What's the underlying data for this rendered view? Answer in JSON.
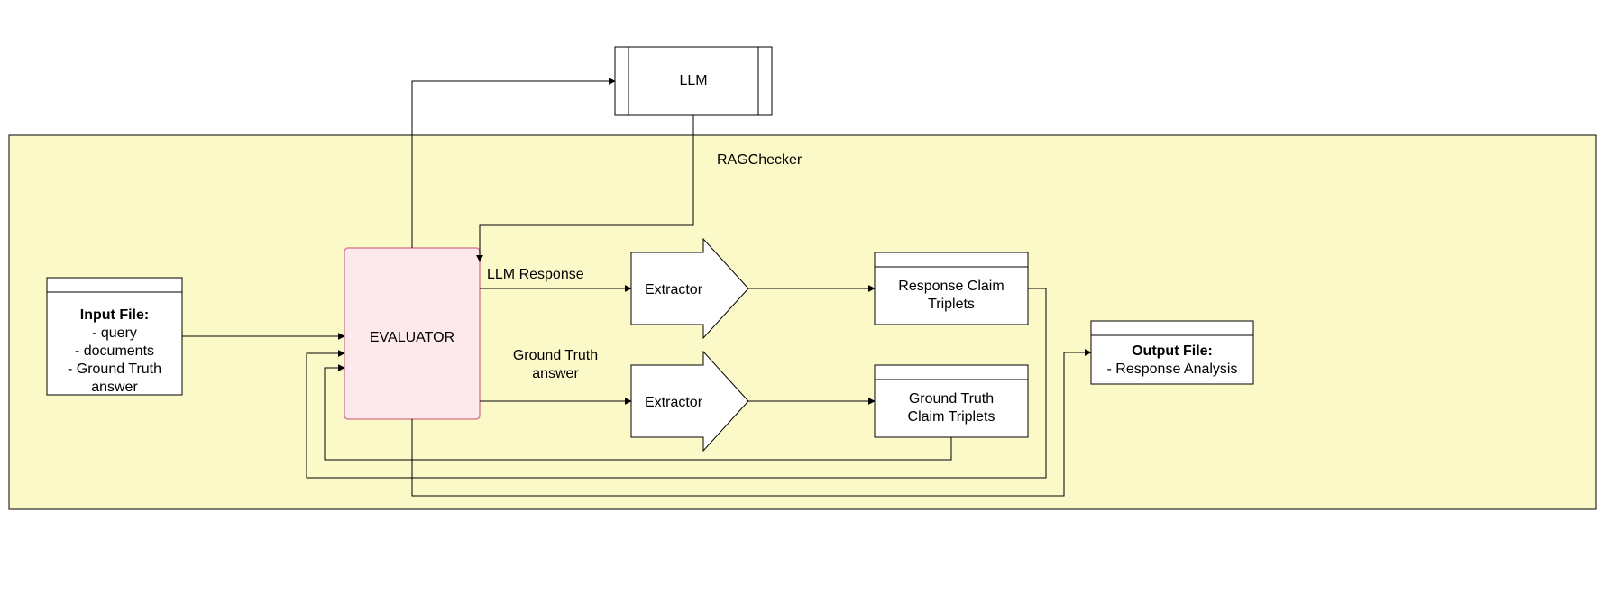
{
  "nodes": {
    "llm": {
      "label": "LLM"
    },
    "ragchecker_label": "RAGChecker",
    "input_file": {
      "title": "Input File:",
      "items": [
        "- query",
        "- documents",
        "- Ground Truth",
        "answer"
      ]
    },
    "evaluator": {
      "label": "EVALUATOR"
    },
    "edge_labels": {
      "llm_response": "LLM Response",
      "ground_truth_answer_line1": "Ground Truth",
      "ground_truth_answer_line2": "answer"
    },
    "extractor1": {
      "label": "Extractor"
    },
    "extractor2": {
      "label": "Extractor"
    },
    "response_triplets": {
      "line1": "Response Claim",
      "line2": "Triplets"
    },
    "groundtruth_triplets": {
      "line1": "Ground Truth",
      "line2": "Claim Triplets"
    },
    "output_file": {
      "title": "Output File:",
      "line1": "- Response Analysis"
    }
  }
}
